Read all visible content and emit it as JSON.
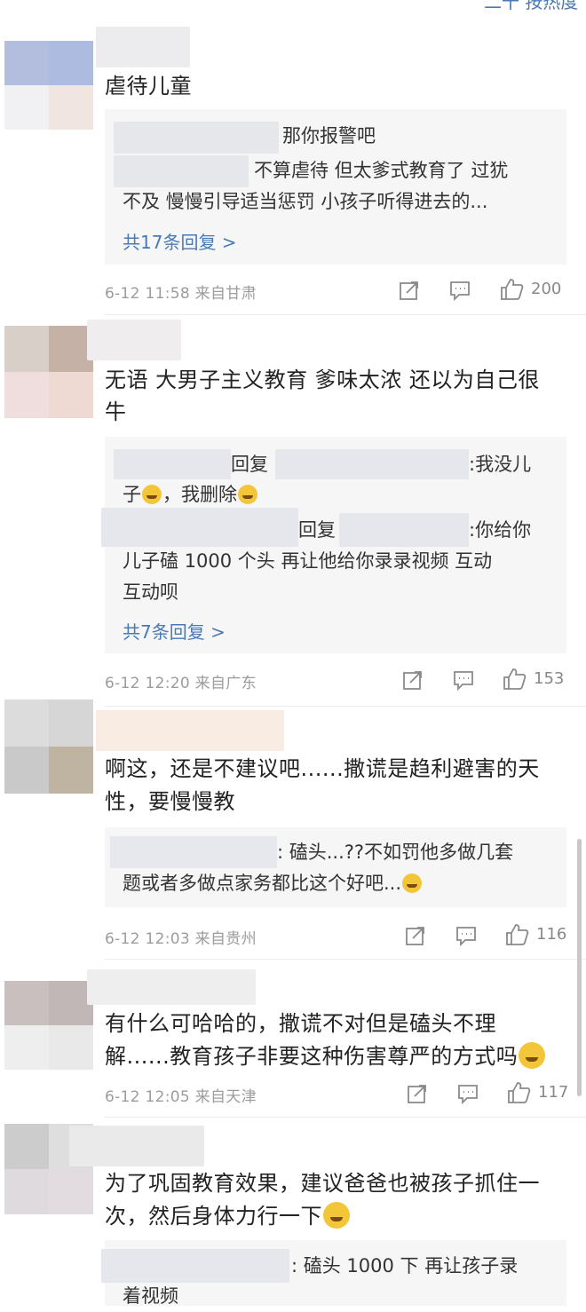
{
  "header": {
    "partial_text": "二十 按热度"
  },
  "colors": {
    "link": "#4a7ab5",
    "meta": "#9c9c9c",
    "reply_bg": "#f6f6f6",
    "accent_emoji": "#f3c63a"
  },
  "comments": [
    {
      "text": "虐待儿童",
      "replies": [
        {
          "text": "那你报警吧"
        },
        {
          "text_l1": "不算虐待 但太爹式教育了 过犹",
          "text_l2": "不及 慢慢引导适当惩罚 小孩子听得进去的..."
        }
      ],
      "more": "共17条回复 >",
      "meta": "6-12 11:58 来自甘肃",
      "likes": "200"
    },
    {
      "text_l1": "无语 大男子主义教育 爹味太浓 还以为自己很",
      "text_l2": "牛",
      "replies": [
        {
          "mid": "回复",
          "tail": ":我没儿",
          "l2a": "子",
          "l2b": "，我删除"
        },
        {
          "mid": "回复",
          "tail": ":你给你",
          "l2": "儿子磕 1000 个头 再让他给你录录视频 互动",
          "l3": "互动呗"
        }
      ],
      "more": "共7条回复 >",
      "meta": "6-12 12:20 来自广东",
      "likes": "153"
    },
    {
      "text_l1": "啊这，还是不建议吧......撒谎是趋利避害的天",
      "text_l2": "性，要慢慢教",
      "replies": [
        {
          "tail": ": 磕头...??不如罚他多做几套",
          "l2": "题或者多做点家务都比这个好吧..."
        }
      ],
      "meta": "6-12 12:03 来自贵州",
      "likes": "116"
    },
    {
      "text_l1": "有什么可哈哈的，撒谎不对但是磕头不理",
      "text_l2": "解......教育孩子非要这种伤害尊严的方式吗",
      "meta": "6-12 12:05 来自天津",
      "likes": "117"
    },
    {
      "text_l1": "为了巩固教育效果，建议爸爸也被孩子抓住一",
      "text_l2": "次，然后身体力行一下",
      "replies": [
        {
          "tail": ": 磕头 1000 下 再让孩子录",
          "l2": "着视频"
        }
      ]
    }
  ],
  "icons": {
    "share": "share-icon",
    "comment": "comment-icon",
    "like": "like-icon"
  }
}
